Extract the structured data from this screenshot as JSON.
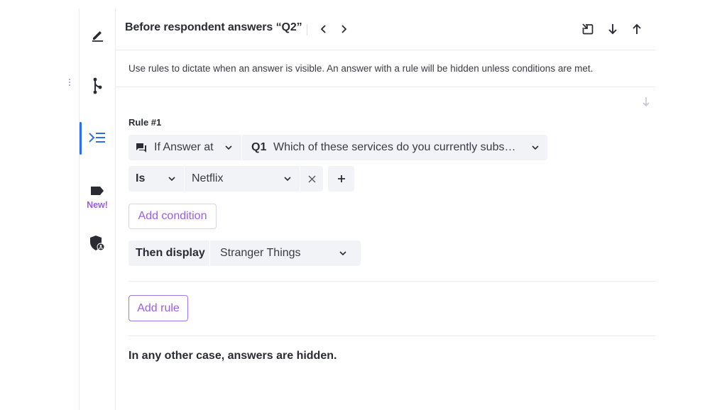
{
  "rail": {
    "new_badge": "New!"
  },
  "header": {
    "title": "Before respondent answers “Q2”"
  },
  "description": "Use rules to dictate when an answer is visible. An answer with a rule will be hidden unless conditions are met.",
  "rule": {
    "label": "Rule #1",
    "source_type": "If Answer at",
    "question_id": "Q1",
    "question_text": "Which of these services do you currently subs…",
    "operator": "Is",
    "value": "Netflix",
    "add_condition_label": "Add condition",
    "then_label": "Then display",
    "then_value": "Stranger Things"
  },
  "add_rule_label": "Add rule",
  "footer": "In any other case, answers are hidden.",
  "colors": {
    "accent_purple": "#9b5de5",
    "active_blue": "#2b6ff0",
    "pill_bg": "#f2f3f6"
  }
}
